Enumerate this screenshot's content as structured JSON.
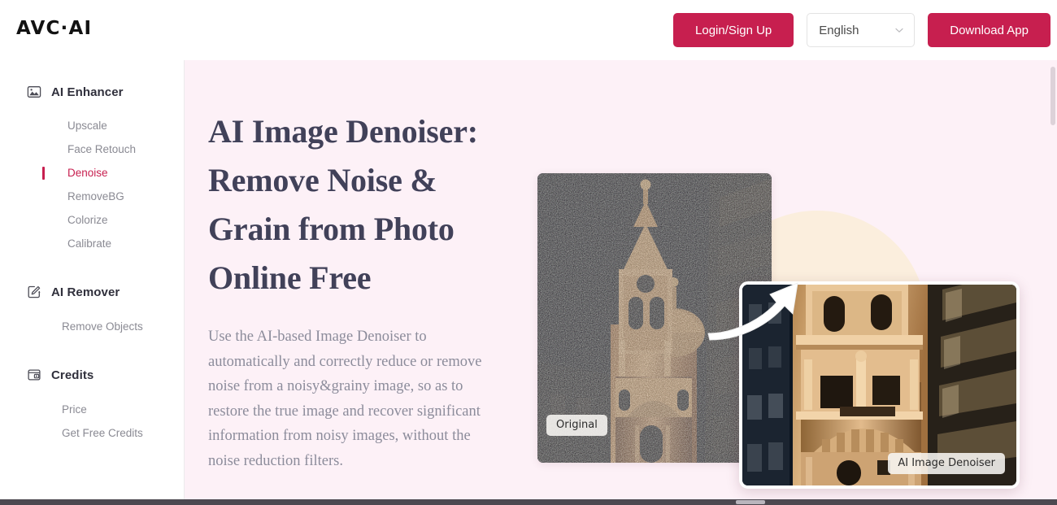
{
  "brand": {
    "logo_text": "AVC·AI"
  },
  "header": {
    "login_label": "Login/Sign Up",
    "language_value": "English",
    "language_icon": "chevron-down-icon",
    "download_label": "Download App",
    "accent_color": "#c71f4f"
  },
  "sidebar": {
    "groups": [
      {
        "label": "AI Enhancer",
        "icon": "image-icon",
        "items": [
          {
            "label": "Upscale",
            "active": false
          },
          {
            "label": "Face Retouch",
            "active": false
          },
          {
            "label": "Denoise",
            "active": true
          },
          {
            "label": "RemoveBG",
            "active": false
          },
          {
            "label": "Colorize",
            "active": false
          },
          {
            "label": "Calibrate",
            "active": false
          }
        ]
      },
      {
        "label": "AI Remover",
        "icon": "magic-wand-icon",
        "items": [
          {
            "label": "Remove Objects",
            "active": false
          }
        ]
      },
      {
        "label": "Credits",
        "icon": "wallet-icon",
        "items": [
          {
            "label": "Price",
            "active": false
          },
          {
            "label": "Get Free Credits",
            "active": false
          }
        ]
      }
    ]
  },
  "hero": {
    "title": "AI Image Denoiser: Remove Noise & Grain from Photo Online Free",
    "description": "Use the AI-based Image Denoiser to automatically and correctly reduce or remove noise from a noisy&grainy image, so as to restore the true image and recover significant information from noisy images, without the noise reduction filters.",
    "background_color": "#fdf1f7",
    "title_color": "#414159"
  },
  "compare": {
    "original_badge": "Original",
    "result_badge": "AI Image Denoiser",
    "arrow_icon": "curved-arrow-up-right-icon"
  }
}
